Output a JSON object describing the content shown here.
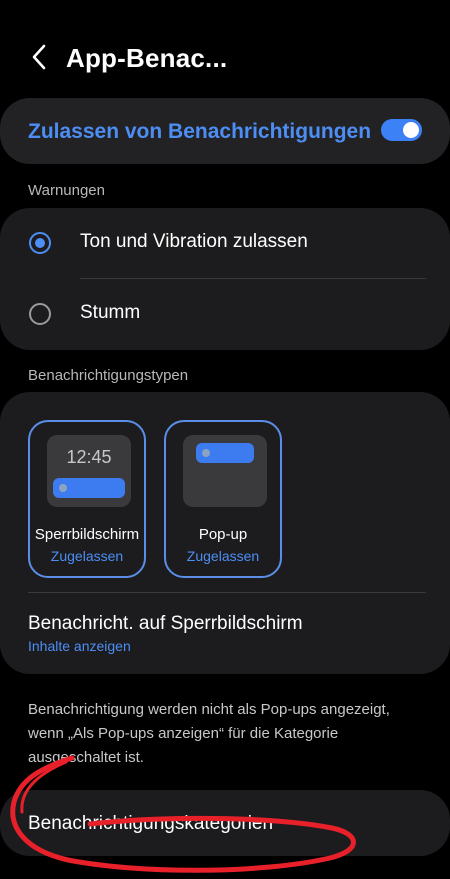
{
  "header": {
    "title": "App-Benac...",
    "back_icon": "chevron-left-icon"
  },
  "master": {
    "label": "Zulassen von Benachrichtigungen",
    "enabled": true
  },
  "warnings": {
    "section_title": "Warnungen",
    "options": [
      {
        "label": "Ton und Vibration zulassen",
        "selected": true
      },
      {
        "label": "Stumm",
        "selected": false
      }
    ]
  },
  "types": {
    "section_title": "Benachrichtigungstypen",
    "tiles": [
      {
        "label": "Sperrbildschirm",
        "status": "Zugelassen",
        "clock": "12:45"
      },
      {
        "label": "Pop-up",
        "status": "Zugelassen"
      }
    ],
    "lockscreen": {
      "title": "Benachricht. auf Sperrbildschirm",
      "subtitle": "Inhalte anzeigen"
    }
  },
  "info_text": "Benachrichtigung werden nicht als Pop-ups angezeigt, wenn „Als Pop-ups anzeigen“ für die Kategorie ausgeschaltet ist.",
  "categories": {
    "label": "Benachrichtigungskategorien"
  },
  "colors": {
    "accent": "#4d8ef5",
    "toggle": "#3c82f6",
    "annotation": "#e8202a"
  }
}
